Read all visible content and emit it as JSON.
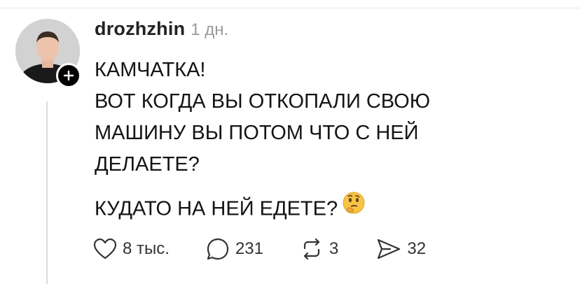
{
  "post": {
    "username": "drozhzhin",
    "time": "1 дн.",
    "lines": [
      "КАМЧАТКА!",
      "ВОТ КОГДА ВЫ ОТКОПАЛИ СВОЮ",
      "МАШИНУ ВЫ ПОТОМ ЧТО С НЕЙ",
      "ДЕЛАЕТЕ?"
    ],
    "line2": "КУДАТО НА НЕЙ ЕДЕТЕ?",
    "emoji": "thinking-face"
  },
  "actions": {
    "likes": "8 тыс.",
    "comments": "231",
    "reposts": "3",
    "shares": "32"
  },
  "icons": [
    "heart-icon",
    "comment-icon",
    "repost-icon",
    "share-icon",
    "plus-icon"
  ],
  "colors": {
    "text": "#141414",
    "muted": "#9a9a9a",
    "badge": "#000000"
  }
}
